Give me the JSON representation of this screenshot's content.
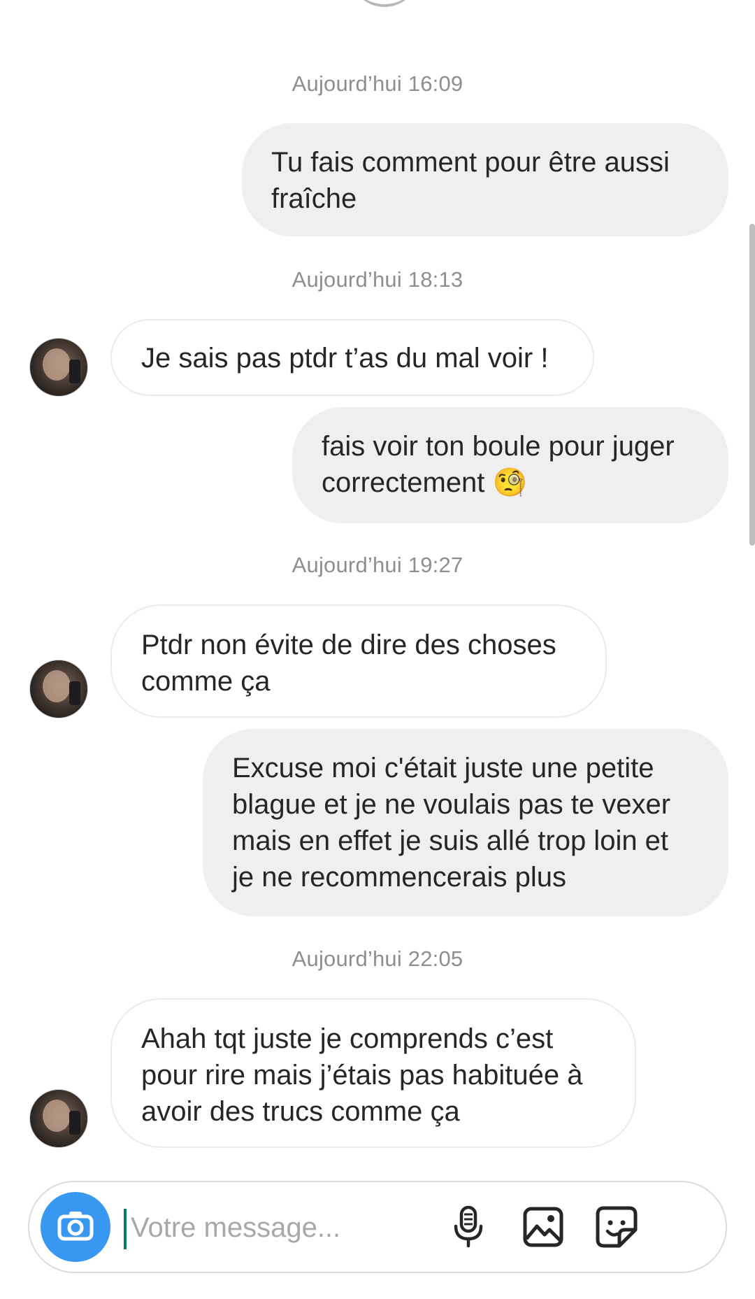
{
  "thread": {
    "timestamps": [
      "Aujourd’hui 16:09",
      "Aujourd’hui 18:13",
      "Aujourd’hui 19:27",
      "Aujourd’hui 22:05"
    ],
    "messages": [
      {
        "direction": "outgoing",
        "text": "Tu fais comment pour être aussi\nfraîche"
      },
      {
        "direction": "incoming",
        "text": "Je sais pas ptdr t’as du mal voir !"
      },
      {
        "direction": "outgoing",
        "text": "fais voir ton boule pour juger\ncorrectement 🧐"
      },
      {
        "direction": "incoming",
        "text": "Ptdr non évite de dire des choses\ncomme ça"
      },
      {
        "direction": "outgoing",
        "text": "Excuse moi c'était juste une petite\nblague et je ne voulais pas te vexer\nmais en effet je suis allé trop loin et\nje ne recommencerais  plus"
      },
      {
        "direction": "incoming",
        "text": "Ahah tqt juste je comprends c’est\npour rire mais j’étais pas habituée à\navoir des trucs comme ça"
      }
    ]
  },
  "composer": {
    "placeholder": "Votre message...",
    "value": "",
    "icons": [
      "camera-icon",
      "microphone-icon",
      "gallery-icon",
      "sticker-icon"
    ],
    "accent_color": "#3897f0"
  }
}
